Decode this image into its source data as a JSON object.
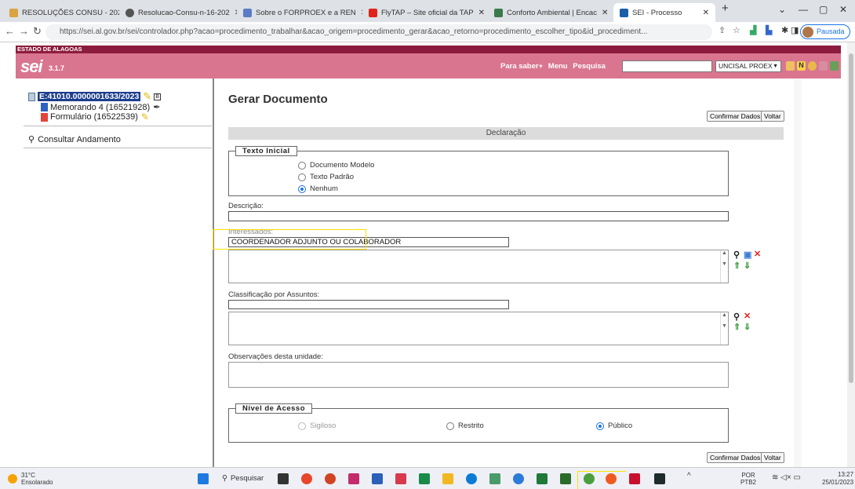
{
  "browser": {
    "tabs": [
      {
        "label": "RESOLUÇÕES CONSU - 202",
        "color": "#d9a441"
      },
      {
        "label": "Resolucao-Consu-n-16-202",
        "color": "#555"
      },
      {
        "label": "Sobre o FORPROEX e a REN",
        "color": "#5b7cc4"
      },
      {
        "label": "FlyTAP – Site oficial da TAP",
        "color": "#e0241b"
      },
      {
        "label": "Conforto Ambiental | Encac",
        "color": "#3b7a4a"
      },
      {
        "label": "SEI - Processo",
        "color": "#1a5ea8"
      }
    ],
    "url": "https://sei.al.gov.br/sei/controlador.php?acao=procedimento_trabalhar&acao_origem=procedimento_gerar&acao_retorno=procedimento_escolher_tipo&id_procediment...",
    "profile": "Pausada"
  },
  "sei": {
    "state": "ESTADO DE ALAGOAS",
    "logo": "sei",
    "version": "3.1.7",
    "links": [
      "Para saber+",
      "Menu",
      "Pesquisa"
    ],
    "unit": "UNCISAL PROEX"
  },
  "tree": {
    "process": "E:41010.0000001633/2023",
    "docs": [
      "Memorando 4 (16521928)",
      "Formulário (16522539)"
    ],
    "consult": "Consultar Andamento"
  },
  "form": {
    "title": "Gerar Documento",
    "confirm": "Confirmar Dados",
    "back": "Voltar",
    "doc_type": "Declaração",
    "texto_inicial": "Texto Inicial",
    "radio_texto": [
      "Documento Modelo",
      "Texto Padrão",
      "Nenhum"
    ],
    "descricao_label": "Descrição:",
    "interessados_label": "Interessados:",
    "interessados_value": "COORDENADOR ADJUNTO OU COLABORADOR",
    "classificacao_label": "Classificação por Assuntos:",
    "observacoes_label": "Observações desta unidade:",
    "nivel_acesso": "Nível de Acesso",
    "radio_acesso": [
      "Sigiloso",
      "Restrito",
      "Público"
    ]
  },
  "taskbar": {
    "temp": "31°C",
    "weather": "Ensolarado",
    "search": "Pesquisar",
    "lang1": "POR",
    "lang2": "PTB2",
    "time": "13:27",
    "date": "25/01/2023"
  }
}
